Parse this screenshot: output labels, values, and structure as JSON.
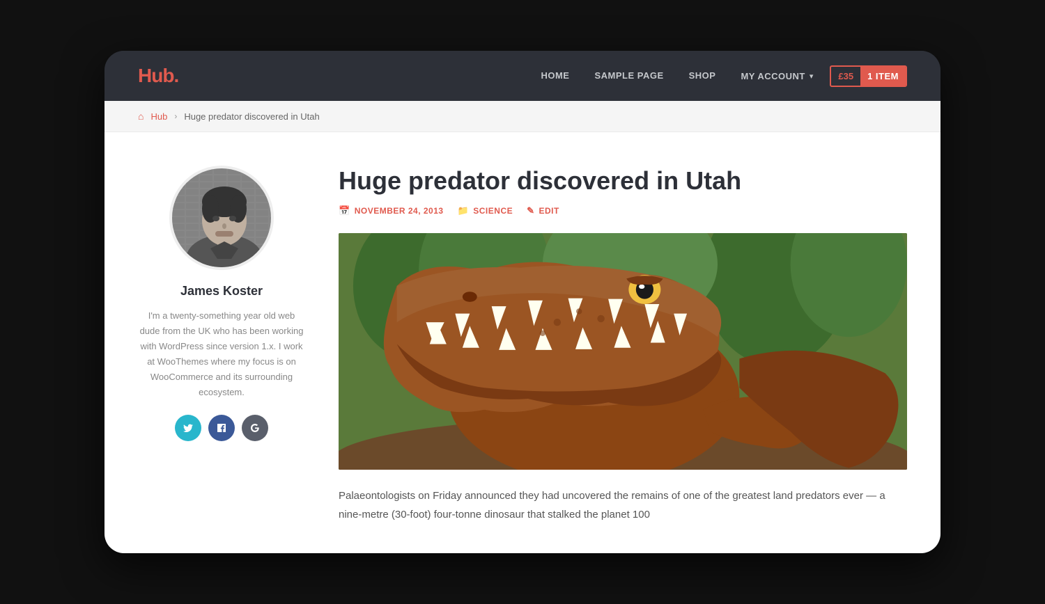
{
  "nav": {
    "logo_text": "Hub",
    "logo_dot": ".",
    "links": [
      {
        "label": "HOME",
        "href": "#"
      },
      {
        "label": "SAMPLE PAGE",
        "href": "#"
      },
      {
        "label": "SHOP",
        "href": "#"
      }
    ],
    "my_account_label": "MY ACCOUNT",
    "cart_price": "£35",
    "cart_items_label": "1 ITEM"
  },
  "breadcrumb": {
    "home_label": "Hub",
    "current": "Huge predator discovered in Utah"
  },
  "article": {
    "title": "Huge predator discovered in Utah",
    "date": "NOVEMBER 24, 2013",
    "category": "SCIENCE",
    "edit_label": "EDIT",
    "excerpt": "Palaeontologists on Friday announced they had uncovered the remains of one of the greatest land predators ever — a nine-metre (30-foot) four-tonne dinosaur that stalked the planet 100"
  },
  "author": {
    "name": "James Koster",
    "bio": "I'm a twenty-something year old web dude from the UK who has been working with WordPress since version 1.x. I work at WooThemes where my focus is on WooCommerce and its surrounding ecosystem.",
    "social": {
      "twitter_label": "t",
      "facebook_label": "f",
      "gplus_label": "g+"
    }
  },
  "colors": {
    "accent": "#e05a4e",
    "nav_bg": "#2d3038",
    "text_dark": "#2d3038",
    "text_muted": "#888888"
  }
}
